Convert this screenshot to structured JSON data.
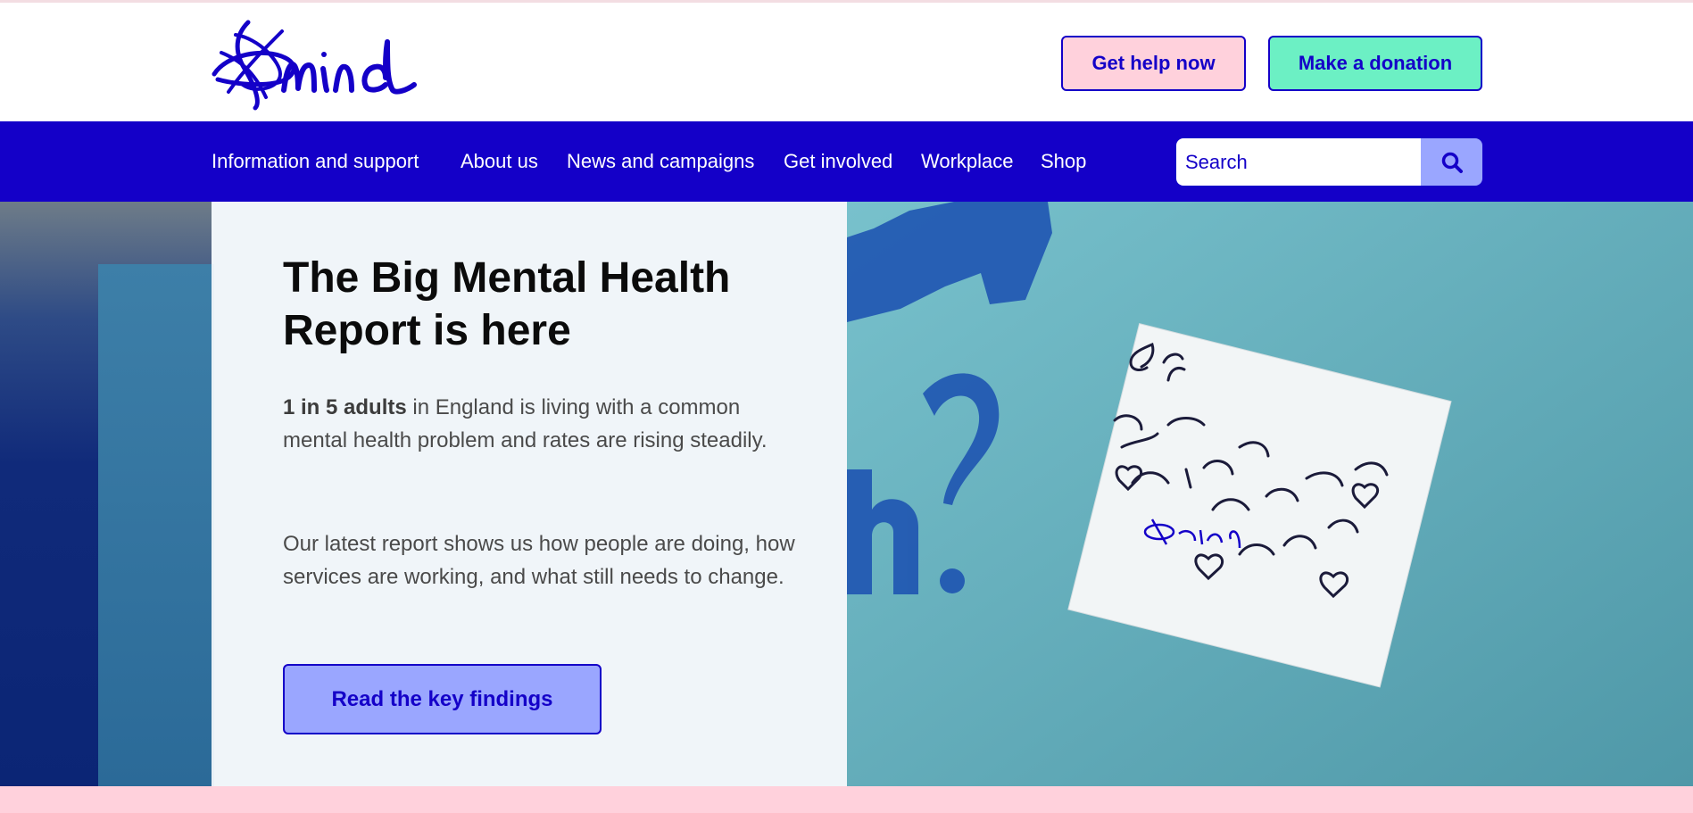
{
  "brand": {
    "logo_text": "mind",
    "color": "#1400c8"
  },
  "header": {
    "help_button": "Get help now",
    "donate_button": "Make a donation"
  },
  "nav": {
    "items": [
      {
        "label": "Information and support"
      },
      {
        "label": "About us"
      },
      {
        "label": "News and campaigns"
      },
      {
        "label": "Get involved"
      },
      {
        "label": "Workplace"
      },
      {
        "label": "Shop"
      }
    ],
    "search_placeholder": "Search",
    "search_icon": "search-icon"
  },
  "hero": {
    "title": "The Big Mental Health Report is here",
    "stat_bold": "1 in 5 adults",
    "stat_rest": " in England is living with a common mental health problem and rates are rising steadily.",
    "body": "Our latest report shows us how people are doing, how services are working, and what still needs to change.",
    "cta": "Read the key findings"
  },
  "colors": {
    "primary": "#1400c8",
    "help_bg": "#ffd1dc",
    "donate_bg": "#6cf0c4",
    "cta_bg": "#9aa6ff"
  }
}
